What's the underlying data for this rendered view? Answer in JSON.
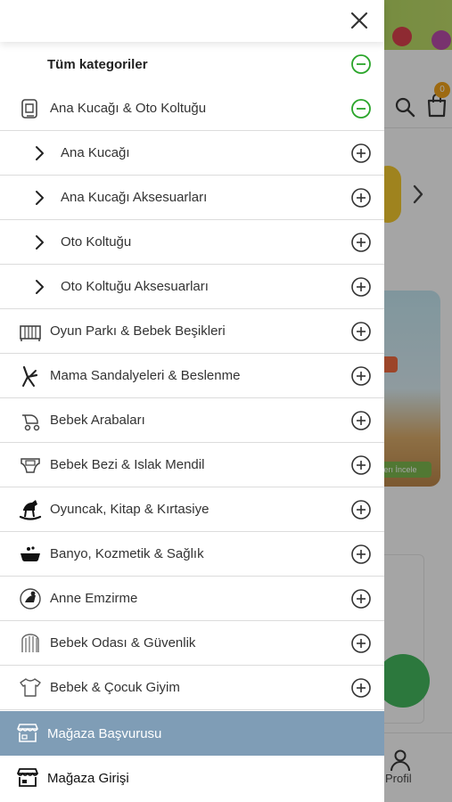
{
  "colors": {
    "accent_green": "#2aa52a",
    "store_apply_bg": "#7f9db6",
    "cart_badge": "#f29900"
  },
  "background": {
    "cart_count": "0",
    "promo_cta": "lerı İncele",
    "profile_label": "Profil"
  },
  "drawer": {
    "close_icon": "close-icon",
    "all_categories": {
      "label": "Tüm kategoriler",
      "state": "expanded"
    },
    "categories": [
      {
        "label": "Ana Kucağı & Oto Koltuğu",
        "icon": "car-seat-icon",
        "state": "expanded",
        "children": [
          {
            "label": "Ana Kucağı"
          },
          {
            "label": "Ana Kucağı Aksesuarları"
          },
          {
            "label": "Oto Koltuğu"
          },
          {
            "label": "Oto Koltuğu Aksesuarları"
          }
        ]
      },
      {
        "label": "Oyun Parkı & Bebek Beşikleri",
        "icon": "crib-icon",
        "state": "collapsed"
      },
      {
        "label": "Mama Sandalyeleri & Beslenme",
        "icon": "high-chair-icon",
        "state": "collapsed"
      },
      {
        "label": "Bebek Arabaları",
        "icon": "stroller-icon",
        "state": "collapsed"
      },
      {
        "label": "Bebek Bezi & Islak Mendil",
        "icon": "diaper-icon",
        "state": "collapsed"
      },
      {
        "label": "Oyuncak, Kitap & Kırtasiye",
        "icon": "rocking-horse-icon",
        "state": "collapsed"
      },
      {
        "label": "Banyo, Kozmetik & Sağlık",
        "icon": "bathtub-icon",
        "state": "collapsed"
      },
      {
        "label": "Anne Emzirme",
        "icon": "breastfeeding-icon",
        "state": "collapsed"
      },
      {
        "label": "Bebek Odası & Güvenlik",
        "icon": "baby-gate-icon",
        "state": "collapsed"
      },
      {
        "label": "Bebek & Çocuk Giyim",
        "icon": "onesie-icon",
        "state": "collapsed"
      }
    ],
    "store_apply": {
      "label": "Mağaza Başvurusu",
      "icon": "store-icon"
    },
    "store_login": {
      "label": "Mağaza Girişi",
      "icon": "store-icon"
    }
  }
}
